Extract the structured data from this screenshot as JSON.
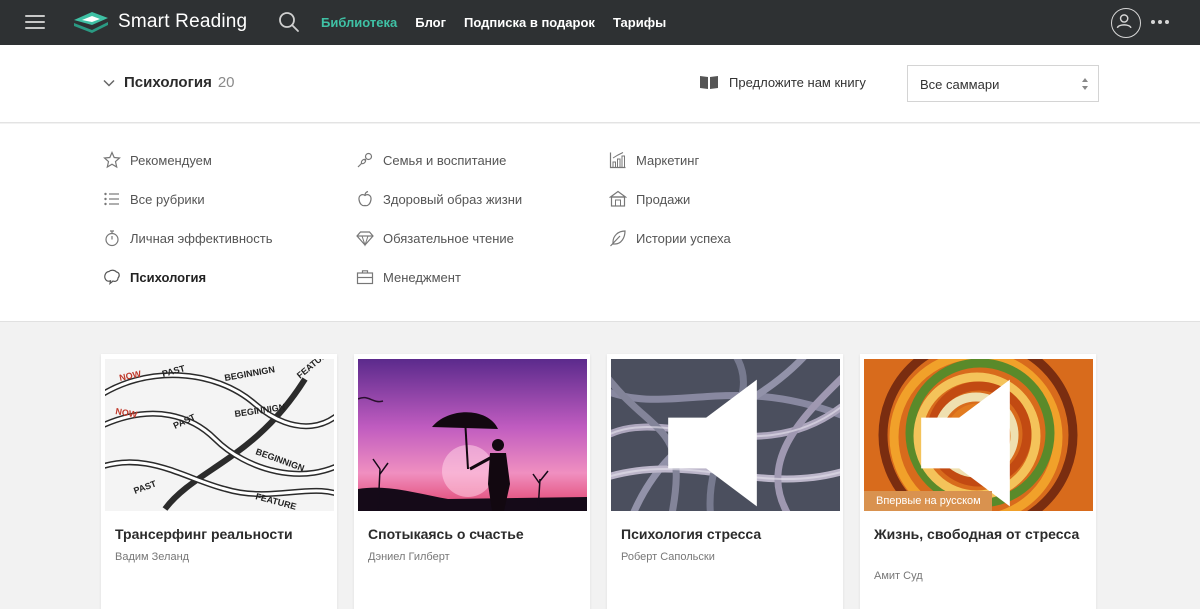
{
  "app": {
    "brand": "Smart Reading",
    "accent": "#3fc1a5",
    "topbar_bg": "#2e3133"
  },
  "nav": [
    {
      "label": "Библиотека",
      "active": true
    },
    {
      "label": "Блог",
      "active": false
    },
    {
      "label": "Подписка в подарок",
      "active": false
    },
    {
      "label": "Тарифы",
      "active": false
    }
  ],
  "header": {
    "category": "Психология",
    "count": "20",
    "suggest_label": "Предложите нам книгу",
    "select_value": "Все саммари"
  },
  "categories": [
    {
      "label": "Рекомендуем",
      "icon": "star-icon"
    },
    {
      "label": "Все рубрики",
      "icon": "list-icon"
    },
    {
      "label": "Личная эффективность",
      "icon": "stopwatch-icon"
    },
    {
      "label": "Психология",
      "icon": "brain-chat-icon",
      "current": true
    },
    {
      "label": "Семья и воспитание",
      "icon": "pacifier-icon"
    },
    {
      "label": "Здоровый образ жизни",
      "icon": "apple-icon"
    },
    {
      "label": "Обязательное чтение",
      "icon": "diamond-icon"
    },
    {
      "label": "Менеджмент",
      "icon": "briefcase-icon"
    },
    {
      "label": "Маркетинг",
      "icon": "chart-icon"
    },
    {
      "label": "Продажи",
      "icon": "shop-icon"
    },
    {
      "label": "Истории успеха",
      "icon": "feather-icon"
    }
  ],
  "books": [
    {
      "title": "Трансерфинг реальности",
      "author": "Вадим Зеланд",
      "cover_words": [
        "NOW",
        "PAST",
        "BEGINNIGN",
        "FEATURE",
        "BEGINNIGN",
        "PAST",
        "NOW",
        "BEGINNIGN",
        "PAST",
        "FEATURE"
      ]
    },
    {
      "title": "Спотыкаясь о счастье",
      "author": "Дэниел Гилберт"
    },
    {
      "title": "Психология стресса",
      "author": "Роберт Сапольски",
      "audio": true
    },
    {
      "title": "Жизнь, свободная от стресса",
      "author": "Амит Суд",
      "audio": true,
      "badge": "Впервые на русском"
    }
  ]
}
